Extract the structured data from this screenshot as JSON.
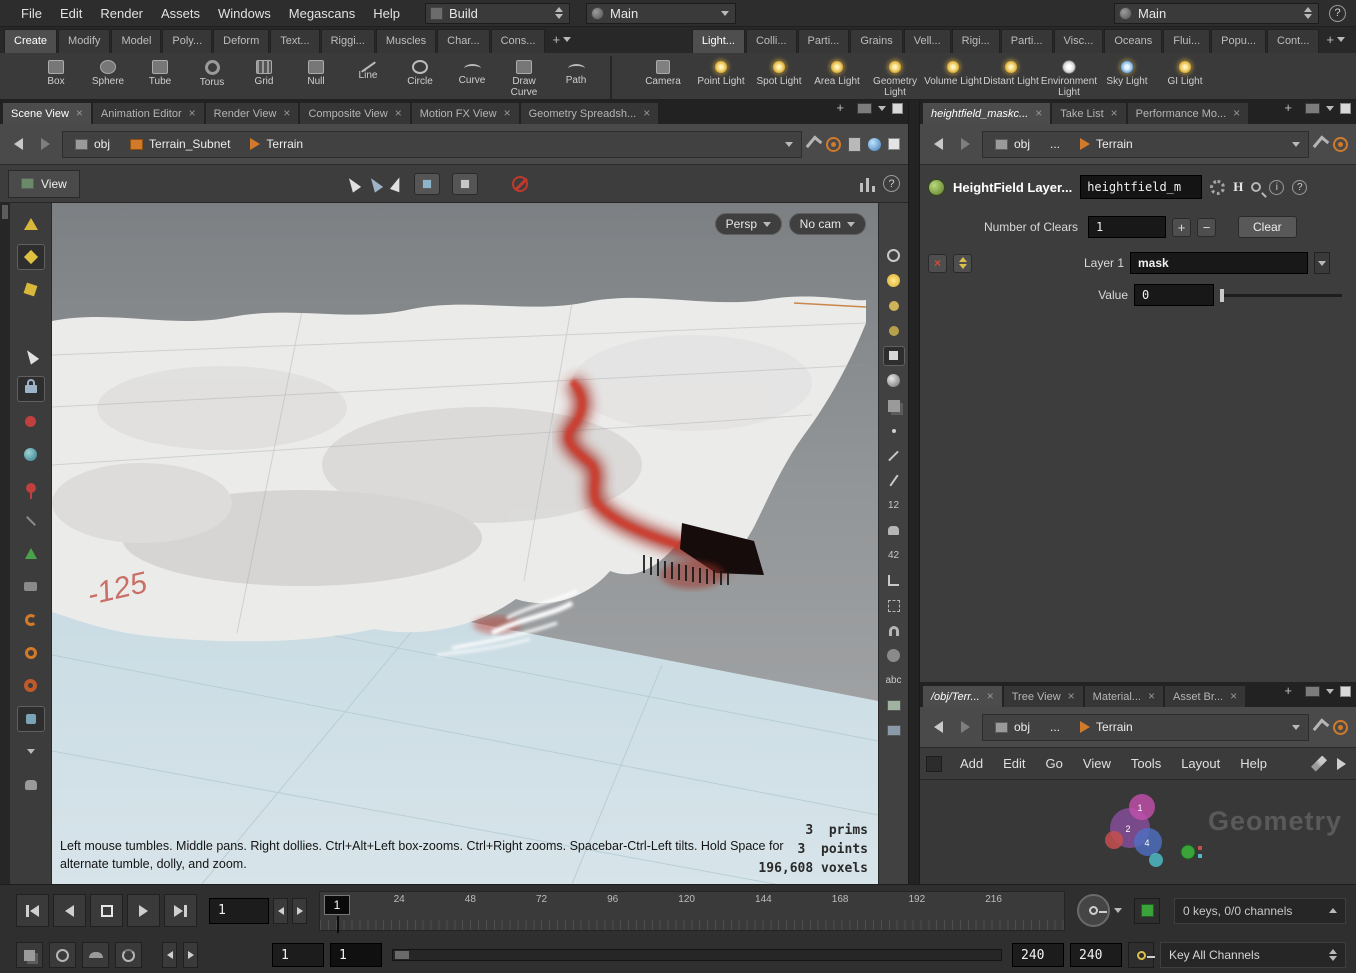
{
  "menubar": {
    "menus": [
      "File",
      "Edit",
      "Render",
      "Assets",
      "Windows",
      "Megascans",
      "Help"
    ],
    "desktop_combo": "Build",
    "scene_combo": "Main",
    "scene_combo2": "Main"
  },
  "shelf": {
    "left_tabs": [
      "Create",
      "Modify",
      "Model",
      "Poly...",
      "Deform",
      "Text...",
      "Riggi...",
      "Muscles",
      "Char...",
      "Cons..."
    ],
    "right_tabs": [
      "Light...",
      "Colli...",
      "Parti...",
      "Grains",
      "Vell...",
      "Rigi...",
      "Parti...",
      "Visc...",
      "Oceans",
      "Flui...",
      "Popu...",
      "Cont..."
    ],
    "left_tools": [
      {
        "label": "Box"
      },
      {
        "label": "Sphere"
      },
      {
        "label": "Tube"
      },
      {
        "label": "Torus"
      },
      {
        "label": "Grid"
      },
      {
        "label": "Null"
      },
      {
        "label": "Line"
      },
      {
        "label": "Circle"
      },
      {
        "label": "Curve"
      },
      {
        "label": "Draw Curve"
      },
      {
        "label": "Path"
      }
    ],
    "right_tools": [
      {
        "label": "Camera"
      },
      {
        "label": "Point Light"
      },
      {
        "label": "Spot Light"
      },
      {
        "label": "Area Light"
      },
      {
        "label": "Geometry Light"
      },
      {
        "label": "Volume Light"
      },
      {
        "label": "Distant Light"
      },
      {
        "label": "Environment Light"
      },
      {
        "label": "Sky Light"
      },
      {
        "label": "GI Light"
      }
    ]
  },
  "scene_pane": {
    "tabs": [
      "Scene View",
      "Animation Editor",
      "Render View",
      "Composite View",
      "Motion FX View",
      "Geometry Spreadsh..."
    ],
    "breadcrumb": [
      "obj",
      "Terrain_Subnet",
      "Terrain"
    ],
    "view_label": "View",
    "persp_button": "Persp",
    "nocam_button": "No cam",
    "grid_coord": "-125",
    "stats": [
      "3  prims",
      "3  points",
      "196,608 voxels"
    ],
    "help_line1": "Left mouse tumbles. Middle pans. Right dollies. Ctrl+Alt+Left box-zooms. Ctrl+Right zooms. Spacebar-Ctrl-Left tilts. Hold Space for",
    "help_line2": "alternate tumble, dolly, and zoom.",
    "tool_12": "12",
    "tool_42": "42",
    "abc_tool": "abc"
  },
  "param_pane": {
    "tabs": [
      "heightfield_maskc...",
      "Take List",
      "Performance Mo..."
    ],
    "breadcrumb": [
      "obj",
      "...",
      "Terrain"
    ],
    "node_type": "HeightField Layer...",
    "node_name": "heightfield_m",
    "h_badge": "H",
    "clears_label": "Number of Clears",
    "clears_value": "1",
    "plus": "+",
    "minus": "−",
    "clear_button": "Clear",
    "layer_label": "Layer 1",
    "layer_value": "mask",
    "value_label": "Value",
    "value_field": "0"
  },
  "network_pane": {
    "tabs": [
      "/obj/Terr...",
      "Tree View",
      "Material...",
      "Asset Br..."
    ],
    "breadcrumb": [
      "obj",
      "...",
      "Terrain"
    ],
    "menus": [
      "Add",
      "Edit",
      "Go",
      "View",
      "Tools",
      "Layout",
      "Help"
    ],
    "watermark": "Geometry",
    "badges": [
      "1",
      "2",
      "4"
    ]
  },
  "playbar": {
    "frame_field": "1",
    "current_frame": "1",
    "ticks": [
      "1",
      "24",
      "48",
      "72",
      "96",
      "120",
      "144",
      "168",
      "192",
      "216"
    ],
    "range_start_a": "1",
    "range_start_b": "1",
    "range_end_a": "240",
    "range_end_b": "240",
    "keys_summary": "0 keys, 0/0 channels",
    "key_all": "Key All Channels"
  }
}
